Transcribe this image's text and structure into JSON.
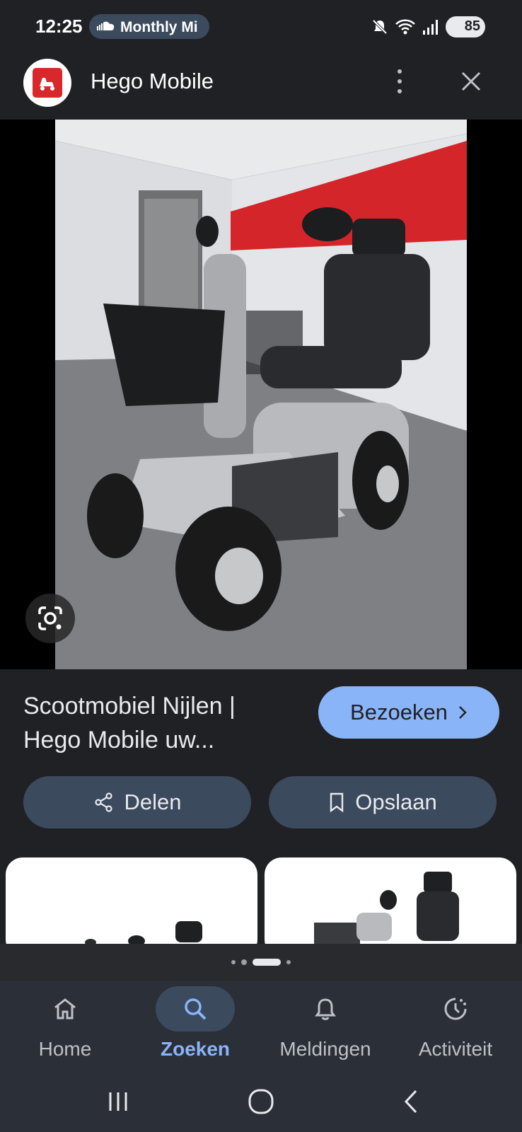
{
  "status_bar": {
    "time": "12:25",
    "media_label": "Monthly Mi",
    "battery": "85"
  },
  "header": {
    "site_name": "Hego Mobile"
  },
  "result": {
    "title": "Scootmobiel Nijlen | Hego Mobile uw...",
    "visit_label": "Bezoeken",
    "share_label": "Delen",
    "save_label": "Opslaan"
  },
  "bottom_nav": {
    "items": [
      {
        "label": "Home",
        "icon": "home-icon",
        "active": false
      },
      {
        "label": "Zoeken",
        "icon": "search-icon",
        "active": true
      },
      {
        "label": "Meldingen",
        "icon": "bell-icon",
        "active": false
      },
      {
        "label": "Activiteit",
        "icon": "activity-icon",
        "active": false
      }
    ]
  },
  "colors": {
    "background": "#202124",
    "accent": "#8ab4f8",
    "pill": "#3c4a5e",
    "nav_bg": "#2b2f38"
  }
}
